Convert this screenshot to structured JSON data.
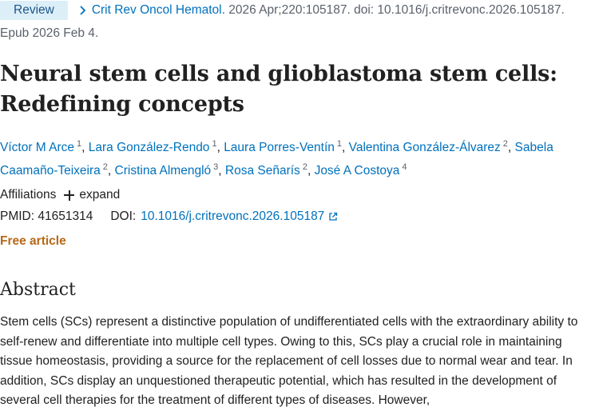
{
  "citation": {
    "badge": "Review",
    "journal": "Crit Rev Oncol Hematol.",
    "details": "2026 Apr;220:105187. doi: 10.1016/j.critrevonc.2026.105187.",
    "epub": "Epub 2026 Feb 4."
  },
  "title": "Neural stem cells and glioblastoma stem cells: Redefining concepts",
  "authors": [
    {
      "name": "Víctor M Arce",
      "aff": "1",
      "sep": ","
    },
    {
      "name": "Lara González-Rendo",
      "aff": "1",
      "sep": ","
    },
    {
      "name": "Laura Porres-Ventín",
      "aff": "1",
      "sep": ","
    },
    {
      "name": "Valentina González-Álvarez",
      "aff": "2",
      "sep": ","
    },
    {
      "name": "Sabela Caamaño-Teixeira",
      "aff": "2",
      "sep": ","
    },
    {
      "name": "Cristina Almengló",
      "aff": "3",
      "sep": ","
    },
    {
      "name": "Rosa Señarís",
      "aff": "2",
      "sep": ","
    },
    {
      "name": "José A Costoya",
      "aff": "4",
      "sep": ""
    }
  ],
  "affiliations": {
    "label": "Affiliations",
    "expand": "expand"
  },
  "identifiers": {
    "pmid_label": "PMID:",
    "pmid": "41651314",
    "doi_label": "DOI:",
    "doi": "10.1016/j.critrevonc.2026.105187"
  },
  "free_article": "Free article",
  "abstract": {
    "heading": "Abstract",
    "text": "Stem cells (SCs) represent a distinctive population of undifferentiated cells with the extraordinary ability to self-renew and differentiate into multiple cell types. Owing to this, SCs play a crucial role in maintaining tissue homeostasis, providing a source for the replacement of cell losses due to normal wear and tear. In addition, SCs display an unquestioned therapeutic potential, which has resulted in the development of several cell therapies for the treatment of different types of diseases. However,"
  },
  "colors": {
    "link": "#0071bc",
    "badge_bg": "#dceff8",
    "free_article": "#b66817"
  },
  "icons": [
    "chevron-right-icon",
    "plus-icon",
    "external-link-icon"
  ]
}
